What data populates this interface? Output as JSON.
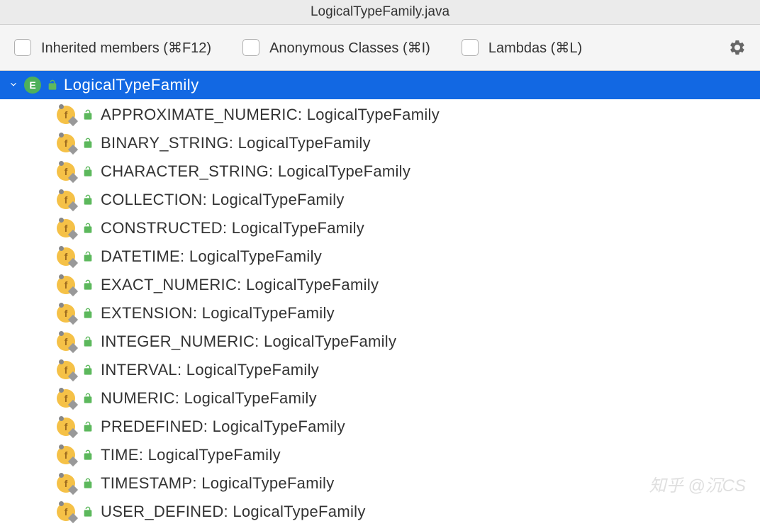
{
  "title": "LogicalTypeFamily.java",
  "toolbar": {
    "inherited": "Inherited members (⌘F12)",
    "anonymous": "Anonymous Classes (⌘I)",
    "lambdas": "Lambdas (⌘L)"
  },
  "class": {
    "name": "LogicalTypeFamily",
    "enum_letter": "E",
    "members": [
      {
        "name": "APPROXIMATE_NUMERIC",
        "type": "LogicalTypeFamily"
      },
      {
        "name": "BINARY_STRING",
        "type": "LogicalTypeFamily"
      },
      {
        "name": "CHARACTER_STRING",
        "type": "LogicalTypeFamily"
      },
      {
        "name": "COLLECTION",
        "type": "LogicalTypeFamily"
      },
      {
        "name": "CONSTRUCTED",
        "type": "LogicalTypeFamily"
      },
      {
        "name": "DATETIME",
        "type": "LogicalTypeFamily"
      },
      {
        "name": "EXACT_NUMERIC",
        "type": "LogicalTypeFamily"
      },
      {
        "name": "EXTENSION",
        "type": "LogicalTypeFamily"
      },
      {
        "name": "INTEGER_NUMERIC",
        "type": "LogicalTypeFamily"
      },
      {
        "name": "INTERVAL",
        "type": "LogicalTypeFamily"
      },
      {
        "name": "NUMERIC",
        "type": "LogicalTypeFamily"
      },
      {
        "name": "PREDEFINED",
        "type": "LogicalTypeFamily"
      },
      {
        "name": "TIME",
        "type": "LogicalTypeFamily"
      },
      {
        "name": "TIMESTAMP",
        "type": "LogicalTypeFamily"
      },
      {
        "name": "USER_DEFINED",
        "type": "LogicalTypeFamily"
      }
    ]
  },
  "field_icon_letter": "f",
  "watermark": "知乎 @沉CS"
}
